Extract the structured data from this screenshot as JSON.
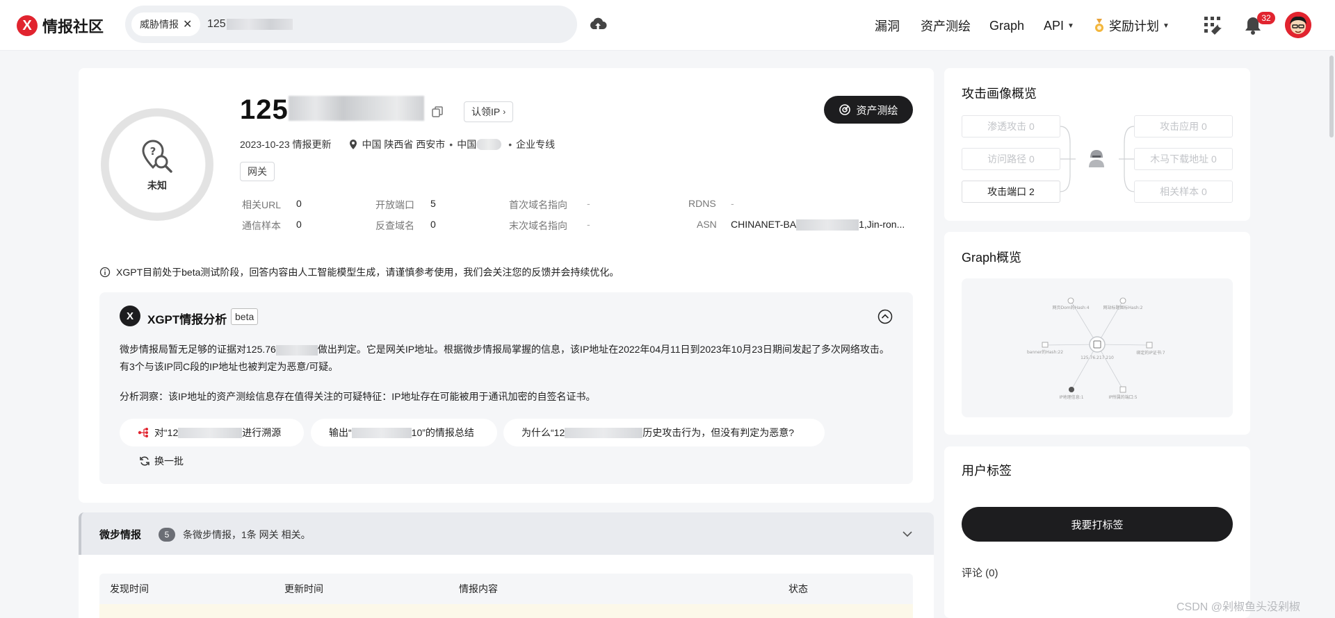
{
  "brand": {
    "name": "情报社区",
    "logo_letter": "X",
    "accent": "#e1242f"
  },
  "search": {
    "chip_label": "威胁情报",
    "chip_close": "✕",
    "query": "125."
  },
  "nav": {
    "vuln": "漏洞",
    "asset_mapping": "资产测绘",
    "graph": "Graph",
    "api": "API",
    "award": "奖励计划",
    "notification_count": "32"
  },
  "ip": {
    "title_prefix": "125.",
    "status_label": "未知",
    "claim_label": "认领IP",
    "asset_button": "资产测绘",
    "updated": "2023-10-23 情报更新",
    "location": "中国 陕西省 西安市",
    "isp_prefix": "中国",
    "line_type": "企业专线",
    "tag": "网关",
    "stats": [
      {
        "key": "相关URL",
        "value": "0"
      },
      {
        "key": "开放端口",
        "value": "5"
      },
      {
        "key": "首次域名指向",
        "value": "-"
      },
      {
        "key": "RDNS",
        "value": "-"
      },
      {
        "key": "通信样本",
        "value": "0"
      },
      {
        "key": "反查域名",
        "value": "0"
      },
      {
        "key": "末次域名指向",
        "value": "-"
      },
      {
        "key": "ASN",
        "value_prefix": "CHINANET-BA",
        "value_suffix": "1,Jin-ron..."
      }
    ]
  },
  "xgpt": {
    "notice": "XGPT目前处于beta测试阶段，回答内容由人工智能模型生成，请谨慎参考使用，我们会关注您的反馈并会持续优化。",
    "title": "XGPT情报分析",
    "beta": "beta",
    "para1_a": "微步情报局暂无足够的证据对125.76",
    "para1_b": "做出判定。它是网关IP地址。根据微步情报局掌握的信息，该IP地址在2022年04月11日到2023年10月23日期间发起了多次网络攻击。有3个与该IP同C段的IP地址也被判定为恶意/可疑。",
    "para2": "分析洞察：该IP地址的资产测绘信息存在值得关注的可疑特征：IP地址存在可能被用于通讯加密的自签名证书。",
    "suggestions": [
      {
        "a": "对“12",
        "b": "进行溯源"
      },
      {
        "a": "输出“",
        "b": "10”的情报总结"
      },
      {
        "a": "为什么“12",
        "b": "历史攻击行为，但没有判定为恶意?"
      }
    ],
    "refresh": "换一批"
  },
  "intel": {
    "title": "微步情报",
    "count": "5",
    "desc": "条微步情报，1条 网关 相关。",
    "columns": [
      "发现时间",
      "更新时间",
      "情报内容",
      "状态"
    ]
  },
  "attack_profile": {
    "title": "攻击画像概览",
    "left_nodes": [
      "渗透攻击 0",
      "访问路径 0",
      "攻击端口 2"
    ],
    "right_nodes": [
      "攻击应用 0",
      "木马下载地址 0",
      "相关样本 0"
    ]
  },
  "graph_overview": {
    "title": "Graph概览",
    "center_label": "125.76.217.210",
    "nodes": [
      "网页Dom的Hash:4",
      "网站标题图标Hash:2",
      "banner的Hash:22",
      "绑定的IP证书:7",
      "IP地理信息:1",
      "IP所属的端口:5"
    ]
  },
  "user_tags": {
    "title": "用户标签",
    "button": "我要打标签",
    "comments": "评论 (0)"
  },
  "watermark": "CSDN @剁椒鱼头没剁椒"
}
